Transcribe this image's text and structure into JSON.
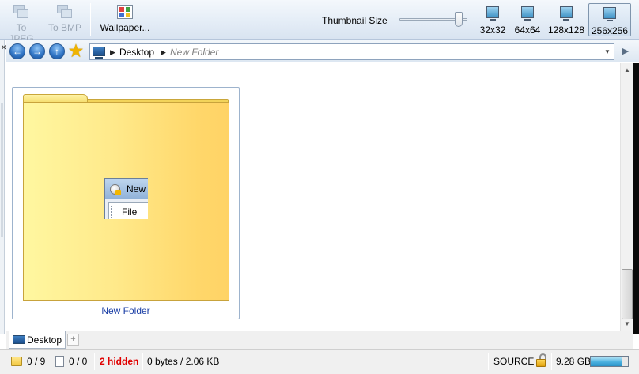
{
  "toolbar": {
    "to_jpeg": "To JPEG",
    "to_bmp": "To BMP",
    "wallpaper": "Wallpaper...",
    "thumbnail_size_label": "Thumbnail Size",
    "thumbnail_slider_fraction": 0.92,
    "sizes": [
      "32x32",
      "64x64",
      "128x128",
      "256x256"
    ],
    "selected_size": "256x256"
  },
  "address": {
    "crumbs": [
      "Desktop",
      "New Folder"
    ],
    "nav_icons": [
      "back-icon",
      "forward-icon",
      "up-icon",
      "favorites-star-icon"
    ]
  },
  "content": {
    "items": [
      {
        "label": "New Folder",
        "preview_title": "New",
        "preview_menu": "File"
      }
    ]
  },
  "tabs": {
    "active": "Desktop",
    "add_symbol": "+"
  },
  "status": {
    "folders": "0 / 9",
    "files": "0 / 0",
    "hidden": "2 hidden",
    "size": "0 bytes / 2.06 KB",
    "source": "SOURCE",
    "free_space": "9.28 GB",
    "disk_used_fraction": 0.85
  },
  "colors": {
    "hidden_text": "#e00000",
    "link_label": "#1a3ea5",
    "folder_light": "#fff7a0",
    "folder_dark": "#ffd366"
  }
}
